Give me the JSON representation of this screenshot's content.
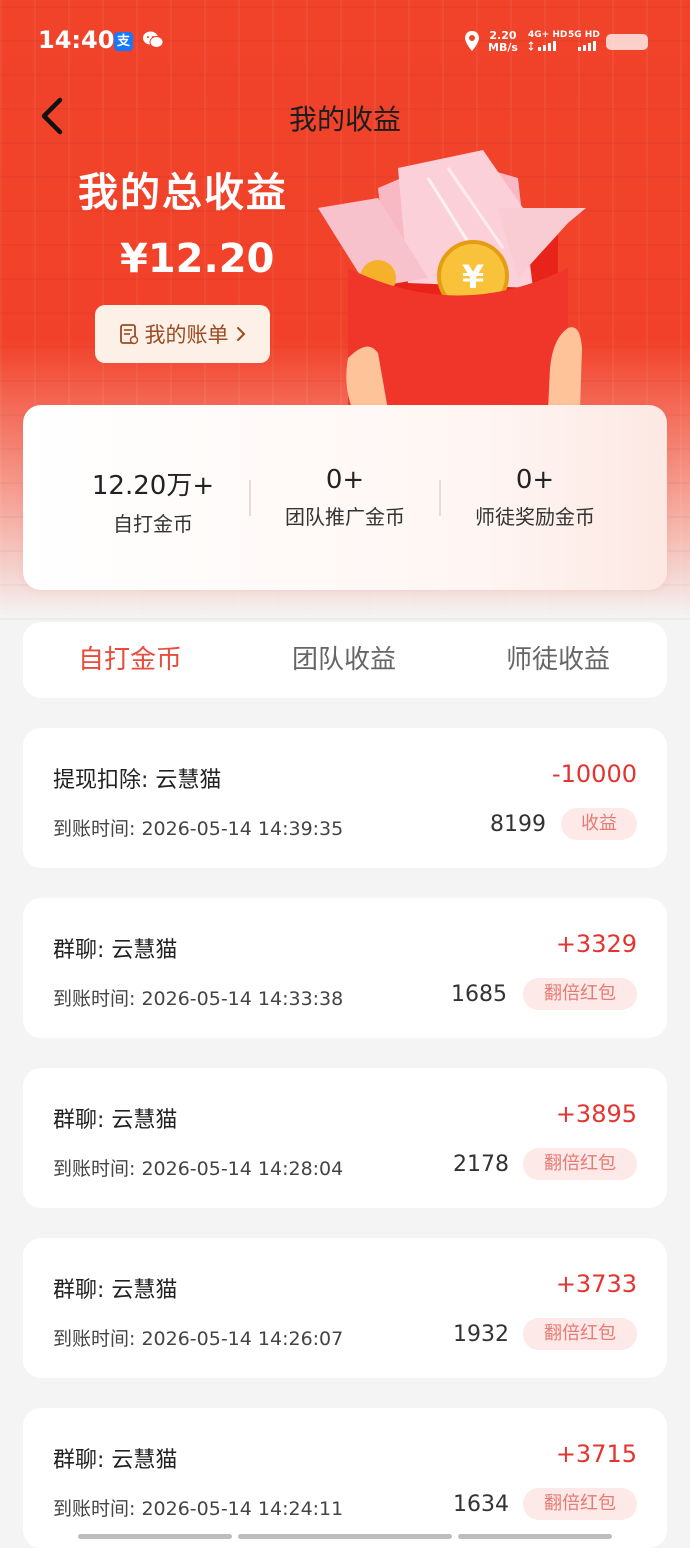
{
  "status_bar": {
    "time": "14:40",
    "alipay_glyph": "支",
    "net_speed_value": "2.20",
    "net_speed_unit": "MB/s",
    "sim1": "4G+ HD",
    "sim2": "5G HD",
    "icons": [
      "alipay-icon",
      "wechat-icon",
      "location-icon",
      "signal-icon",
      "battery-icon"
    ]
  },
  "nav": {
    "title": "我的收益",
    "back_icon": "chevron-left-icon"
  },
  "hero": {
    "title": "我的总收益",
    "amount": "¥12.20",
    "bill_button_label": "我的账单",
    "bill_icon": "receipt-icon",
    "illustration": "red-envelope-with-coin"
  },
  "summary": {
    "stats": [
      {
        "value": "12.20万+",
        "label": "自打金币"
      },
      {
        "value": "0+",
        "label": "团队推广金币"
      },
      {
        "value": "0+",
        "label": "师徒奖励金币"
      }
    ]
  },
  "tabs": [
    {
      "label": "自打金币",
      "active": true
    },
    {
      "label": "团队收益",
      "active": false
    },
    {
      "label": "师徒收益",
      "active": false
    }
  ],
  "records": [
    {
      "title": "提现扣除: 云慧猫",
      "amount": "-10000",
      "time": "到账时间: 2026-05-14 14:39:35",
      "count": "8199",
      "badge": "收益"
    },
    {
      "title": "群聊: 云慧猫",
      "amount": "+3329",
      "time": "到账时间: 2026-05-14 14:33:38",
      "count": "1685",
      "badge": "翻倍红包"
    },
    {
      "title": "群聊: 云慧猫",
      "amount": "+3895",
      "time": "到账时间: 2026-05-14 14:28:04",
      "count": "2178",
      "badge": "翻倍红包"
    },
    {
      "title": "群聊: 云慧猫",
      "amount": "+3733",
      "time": "到账时间: 2026-05-14 14:26:07",
      "count": "1932",
      "badge": "翻倍红包"
    },
    {
      "title": "群聊: 云慧猫",
      "amount": "+3715",
      "time": "到账时间: 2026-05-14 14:24:11",
      "count": "1634",
      "badge": "翻倍红包"
    }
  ],
  "colors": {
    "accent": "#e84c3d",
    "hero_red": "#f0432a",
    "amount_red": "#e3342f",
    "badge_bg": "#fde9e7",
    "badge_text": "#e77a74"
  }
}
